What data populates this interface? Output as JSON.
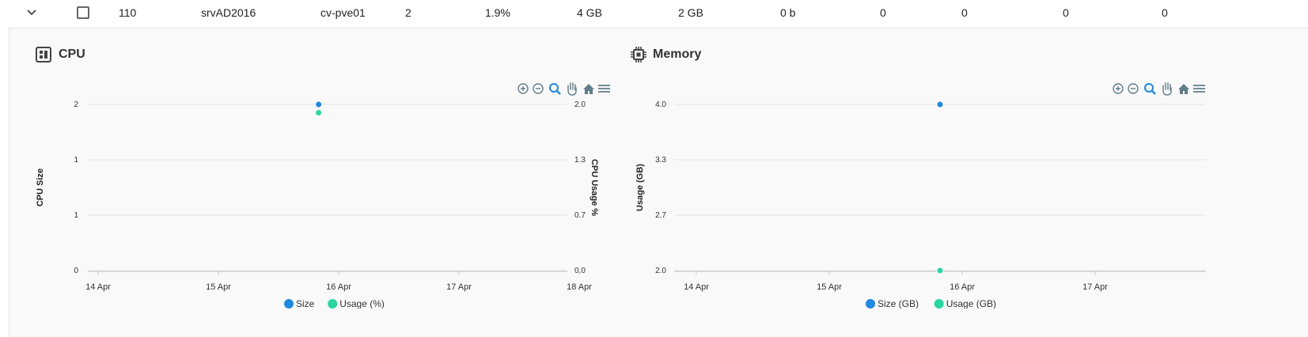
{
  "row": {
    "id": "110",
    "name": "srvAD2016",
    "node": "cv-pve01",
    "cpu": "2",
    "cpu_usage": "1.9%",
    "memory": "4 GB",
    "memory_usage": "2 GB",
    "disk": "0 b",
    "c1": "0",
    "c2": "0",
    "c3": "0",
    "c4": "0"
  },
  "cpu_panel": {
    "title": "CPU",
    "icon": "cpu-chip-icon"
  },
  "memory_panel": {
    "title": "Memory",
    "icon": "memory-chip-icon"
  },
  "colors": {
    "size": "#1e88e5",
    "usage": "#26d7a0",
    "toolbar": "#607d8b"
  },
  "chart_data": [
    {
      "type": "scatter",
      "title": "CPU",
      "ylabel": "CPU Size",
      "y2label": "CPU Usage %",
      "x_ticks": [
        "14 Apr",
        "15 Apr",
        "16 Apr",
        "17 Apr",
        "18 Apr"
      ],
      "y_ticks": [
        "0",
        "1",
        "1",
        "2"
      ],
      "y2_ticks": [
        "0.0",
        "0.7",
        "1.3",
        "2.0"
      ],
      "ylim": [
        0,
        2
      ],
      "y2lim": [
        0,
        2
      ],
      "series": [
        {
          "name": "Size",
          "color": "#1e88e5",
          "points": [
            {
              "x": "15 Apr 20:00",
              "y": 2
            }
          ]
        },
        {
          "name": "Usage (%)",
          "color": "#26d7a0",
          "axis": "right",
          "points": [
            {
              "x": "15 Apr 20:00",
              "y": 1.9
            }
          ]
        }
      ],
      "legend": [
        "Size",
        "Usage (%)"
      ]
    },
    {
      "type": "scatter",
      "title": "Memory",
      "ylabel": "Usage (GB)",
      "x_ticks": [
        "14 Apr",
        "15 Apr",
        "16 Apr",
        "17 Apr"
      ],
      "y_ticks": [
        "2.0",
        "2.7",
        "3.3",
        "4.0"
      ],
      "ylim": [
        2,
        4
      ],
      "series": [
        {
          "name": "Size (GB)",
          "color": "#1e88e5",
          "points": [
            {
              "x": "15 Apr 20:00",
              "y": 4
            }
          ]
        },
        {
          "name": "Usage (GB)",
          "color": "#26d7a0",
          "points": [
            {
              "x": "15 Apr 20:00",
              "y": 2
            }
          ]
        }
      ],
      "legend": [
        "Size (GB)",
        "Usage (GB)"
      ]
    }
  ]
}
